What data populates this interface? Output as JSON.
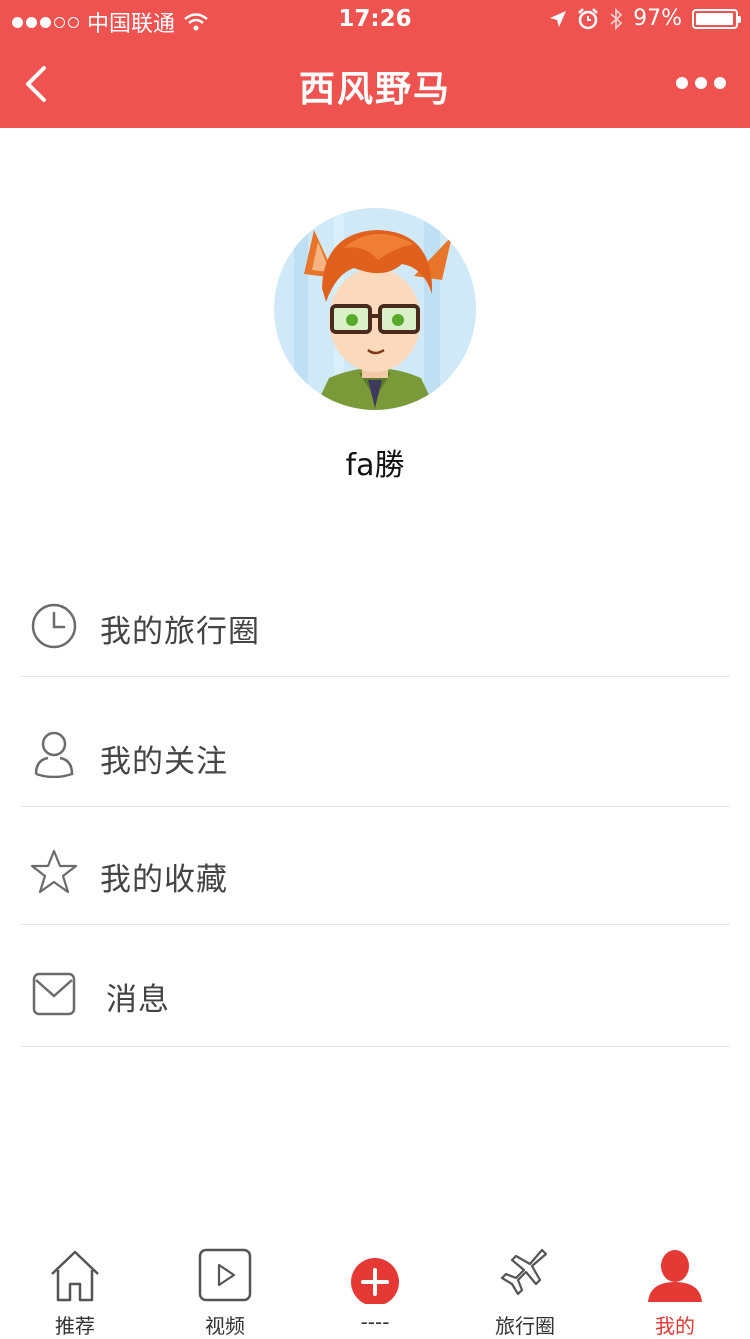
{
  "status_bar": {
    "carrier": "中国联通",
    "time": "17:26",
    "battery": "97%",
    "battery_level": 0.97
  },
  "nav": {
    "title": "西风野马"
  },
  "profile": {
    "username": "fa勝"
  },
  "menu": {
    "items": [
      {
        "label": "我的旅行圈",
        "icon": "clock-icon"
      },
      {
        "label": "我的关注",
        "icon": "person-icon"
      },
      {
        "label": "我的收藏",
        "icon": "star-icon"
      },
      {
        "label": "消息",
        "icon": "mail-icon"
      }
    ]
  },
  "tabbar": {
    "tabs": [
      {
        "label": "推荐",
        "icon": "home-icon",
        "active": false
      },
      {
        "label": "视频",
        "icon": "video-play-icon",
        "active": false
      },
      {
        "label": "----",
        "icon": "add-circle-icon",
        "active": false
      },
      {
        "label": "旅行圈",
        "icon": "plane-icon",
        "active": false
      },
      {
        "label": "我的",
        "icon": "user-icon",
        "active": true
      }
    ],
    "active_color": "#e53935"
  },
  "colors": {
    "header": "#ef5350",
    "accent": "#e53935"
  }
}
